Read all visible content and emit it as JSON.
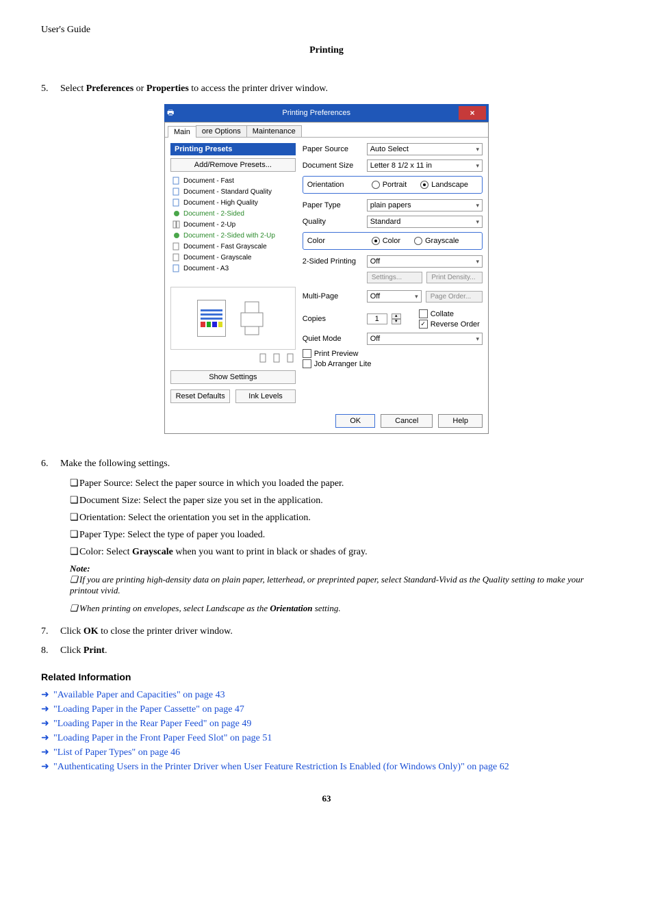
{
  "header": {
    "left": "User's Guide",
    "section": "Printing"
  },
  "step5": {
    "num": "5.",
    "text_parts": [
      "Select ",
      "Preferences",
      " or ",
      "Properties",
      " to access the printer driver window."
    ]
  },
  "dialog": {
    "title": "Printing Preferences",
    "close": "×",
    "tabs": {
      "main": "Main",
      "more": "ore Options",
      "maint": "Maintenance"
    },
    "presets": {
      "title": "Printing Presets",
      "addremove": "Add/Remove Presets...",
      "items": [
        "Document - Fast",
        "Document - Standard Quality",
        "Document - High Quality",
        "Document - 2-Sided",
        "Document - 2-Up",
        "Document - 2-Sided with 2-Up",
        "Document - Fast Grayscale",
        "Document - Grayscale",
        "Document - A3"
      ]
    },
    "show_settings": "Show Settings",
    "reset": "Reset Defaults",
    "ink": "Ink Levels",
    "fields": {
      "paper_source": {
        "label": "Paper Source",
        "value": "Auto Select"
      },
      "doc_size": {
        "label": "Document Size",
        "value": "Letter 8 1/2 x 11 in"
      },
      "orientation": {
        "label": "Orientation",
        "portrait": "Portrait",
        "landscape": "Landscape"
      },
      "paper_type": {
        "label": "Paper Type",
        "value": "plain papers"
      },
      "quality": {
        "label": "Quality",
        "value": "Standard"
      },
      "color": {
        "label": "Color",
        "color": "Color",
        "gray": "Grayscale"
      },
      "twosided": {
        "label": "2-Sided Printing",
        "value": "Off",
        "settings": "Settings...",
        "density": "Print Density..."
      },
      "multipage": {
        "label": "Multi-Page",
        "value": "Off",
        "pageorder": "Page Order..."
      },
      "copies": {
        "label": "Copies",
        "value": "1",
        "collate": "Collate",
        "reverse": "Reverse Order"
      },
      "quiet": {
        "label": "Quiet Mode",
        "value": "Off"
      },
      "preview": "Print Preview",
      "arranger": "Job Arranger Lite"
    },
    "footer": {
      "ok": "OK",
      "cancel": "Cancel",
      "help": "Help"
    }
  },
  "step6": {
    "num": "6.",
    "text": "Make the following settings.",
    "subs": [
      "Paper Source: Select the paper source in which you loaded the paper.",
      "Document Size: Select the paper size you set in the application.",
      "Orientation: Select the orientation you set in the application.",
      "Paper Type: Select the type of paper you loaded."
    ],
    "color_parts": [
      "Color: Select ",
      "Grayscale",
      " when you want to print in black or shades of gray."
    ],
    "note_heading": "Note:",
    "note1": "If you are printing high-density data on plain paper, letterhead, or preprinted paper, select Standard-Vivid as the Quality setting to make your printout vivid.",
    "note2_parts": [
      "When printing on envelopes, select Landscape as the ",
      "Orientation",
      " setting."
    ]
  },
  "step7": {
    "num": "7.",
    "parts": [
      "Click ",
      "OK",
      " to close the printer driver window."
    ]
  },
  "step8": {
    "num": "8.",
    "parts": [
      "Click ",
      "Print",
      "."
    ]
  },
  "related": {
    "heading": "Related Information",
    "links": [
      "\"Available Paper and Capacities\" on page 43",
      "\"Loading Paper in the Paper Cassette\" on page 47",
      "\"Loading Paper in the Rear Paper Feed\" on page 49",
      "\"Loading Paper in the Front Paper Feed Slot\" on page 51",
      "\"List of Paper Types\" on page 46"
    ],
    "long": "\"Authenticating Users in the Printer Driver when User Feature Restriction Is Enabled (for Windows Only)\" on page 62"
  },
  "pagenum": "63"
}
